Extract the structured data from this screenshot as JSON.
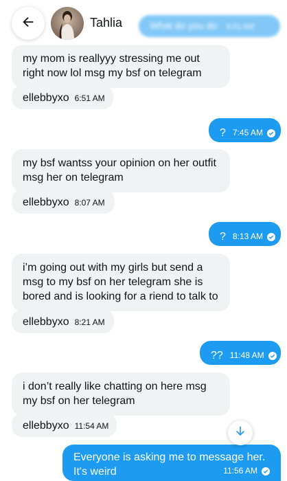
{
  "header": {
    "contact_name": "Tahlia",
    "ghost_message": "What do you do",
    "ghost_time": "6:51 AM"
  },
  "messages": [
    {
      "type": "in",
      "text": "my mom is reallyyy stressing me out right now lol msg my bsf on telegram"
    },
    {
      "type": "in",
      "text": "ellebbyxo",
      "time": "6:51 AM"
    },
    {
      "type": "out",
      "text": "?",
      "time": "7:45 AM"
    },
    {
      "type": "in",
      "text": "my bsf wantss your opinion on her outfit msg her on telegram"
    },
    {
      "type": "in",
      "text": "ellebbyxo",
      "time": "8:07 AM"
    },
    {
      "type": "out",
      "text": "?",
      "time": "8:13 AM"
    },
    {
      "type": "in",
      "text": "i’m going out with my girls but send a msg to my bsf on her telegram she is bored and is looking for a riend to talk to"
    },
    {
      "type": "in",
      "text": "ellebbyxo",
      "time": "8:21 AM"
    },
    {
      "type": "out",
      "text": "??",
      "time": "11:48 AM"
    },
    {
      "type": "in",
      "text": "i don’t really like chatting on here msg my bsf on her telegram"
    },
    {
      "type": "in",
      "text": "ellebbyxo",
      "time": "11:54 AM"
    },
    {
      "type": "out",
      "text": "Everyone is asking me to message her. It's weird",
      "time": "11:56 AM"
    }
  ],
  "colors": {
    "accent": "#1d9bf0",
    "incoming_bubble": "#eff3f4",
    "text": "#0f1419"
  },
  "icons": {
    "back": "arrow-left-icon",
    "scroll": "arrow-down-icon",
    "read": "check-circle-icon"
  }
}
